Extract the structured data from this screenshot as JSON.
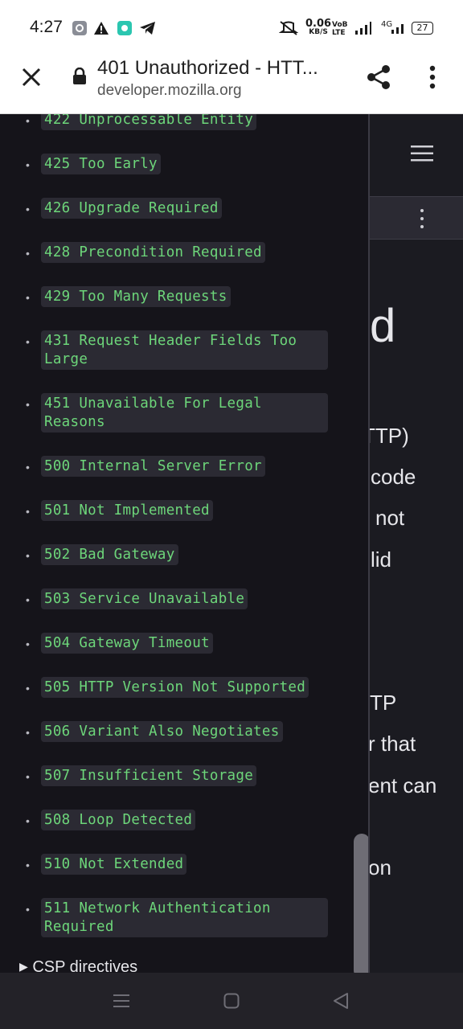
{
  "status_bar": {
    "time": "4:27",
    "net_speed": "0.06",
    "net_unit": "KB/S",
    "volte": "VoB LTE",
    "network": "4G",
    "battery": "27",
    "icons": [
      "settings-app-icon",
      "warning-icon",
      "app-icon",
      "telegram-icon",
      "mute-icon",
      "signal-icon",
      "battery-icon"
    ]
  },
  "url_bar": {
    "title": "401 Unauthorized - HTT...",
    "domain": "developer.mozilla.org"
  },
  "sidebar": {
    "items": [
      {
        "label": "422 Unprocessable Entity"
      },
      {
        "label": "425 Too Early"
      },
      {
        "label": "426 Upgrade Required"
      },
      {
        "label": "428 Precondition Required"
      },
      {
        "label": "429 Too Many Requests"
      },
      {
        "label": "431 Request Header Fields Too Large"
      },
      {
        "label": "451 Unavailable For Legal Reasons"
      },
      {
        "label": "500 Internal Server Error"
      },
      {
        "label": "501 Not Implemented"
      },
      {
        "label": "502 Bad Gateway"
      },
      {
        "label": "503 Service Unavailable"
      },
      {
        "label": "504 Gateway Timeout"
      },
      {
        "label": "505 HTTP Version Not Supported"
      },
      {
        "label": "506 Variant Also Negotiates"
      },
      {
        "label": "507 Insufficient Storage"
      },
      {
        "label": "508 Loop Detected"
      },
      {
        "label": "510 Not Extended"
      },
      {
        "label": "511 Network Authentication Required"
      }
    ],
    "csp_label": "CSP directives"
  },
  "background_page": {
    "fragments": [
      "d",
      "TTP)",
      "code",
      "not",
      "lid",
      "TP",
      "r that",
      "ent can",
      "on"
    ]
  },
  "colors": {
    "sidebar_bg": "#15141a",
    "code_bg": "#2b2a33",
    "code_text": "#6dd67a",
    "page_bg": "#1b1b21"
  }
}
